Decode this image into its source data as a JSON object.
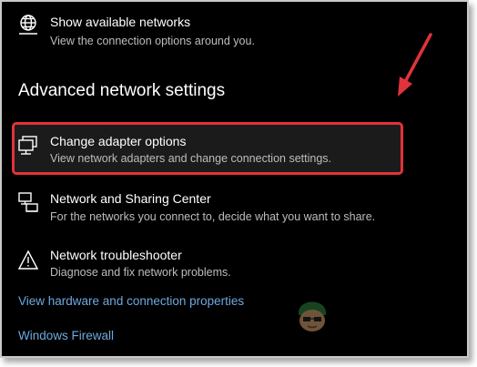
{
  "items": [
    {
      "icon": "globe-network-icon",
      "title": "Show available networks",
      "desc": "View the connection options around you."
    },
    {
      "icon": "monitor-adapter-icon",
      "title": "Change adapter options",
      "desc": "View network adapters and change connection settings."
    },
    {
      "icon": "sharing-center-icon",
      "title": "Network and Sharing Center",
      "desc": "For the networks you connect to, decide what you want to share."
    },
    {
      "icon": "warning-triangle-icon",
      "title": "Network troubleshooter",
      "desc": "Diagnose and fix network problems."
    }
  ],
  "section_heading": "Advanced network settings",
  "links": {
    "hardware": "View hardware and connection properties",
    "firewall": "Windows Firewall"
  },
  "colors": {
    "background": "#000000",
    "highlight_border": "#e1333a",
    "arrow": "#e1333a",
    "link": "#6ca9e0",
    "description": "#bdbdbd"
  }
}
